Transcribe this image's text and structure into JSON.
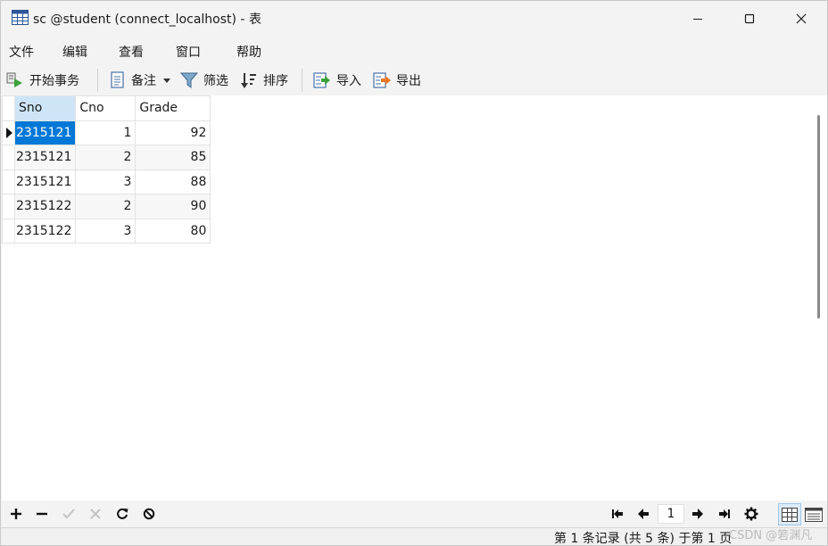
{
  "window": {
    "title": "sc @student (connect_localhost) - 表",
    "icon": "table-grid-icon"
  },
  "menu": [
    "文件",
    "编辑",
    "查看",
    "窗口",
    "帮助"
  ],
  "toolbar": {
    "begin_transaction": "开始事务",
    "memo": "备注",
    "filter": "筛选",
    "sort": "排序",
    "import": "导入",
    "export": "导出"
  },
  "grid": {
    "columns": [
      "Sno",
      "Cno",
      "Grade"
    ],
    "rows": [
      [
        "2315121",
        "1",
        "92"
      ],
      [
        "2315121",
        "2",
        "85"
      ],
      [
        "2315121",
        "3",
        "88"
      ],
      [
        "2315122",
        "2",
        "90"
      ],
      [
        "2315122",
        "3",
        "80"
      ]
    ],
    "selected_row": 0,
    "selected_col": 0
  },
  "nav": {
    "current_page": "1"
  },
  "status": {
    "text": "第 1 条记录 (共 5 条) 于第 1 页"
  },
  "watermark": "CSDN @箬渊凡",
  "colors": {
    "selection": "#0078d7",
    "header_selected": "#cde5f7",
    "chrome": "#f3f3f3"
  }
}
